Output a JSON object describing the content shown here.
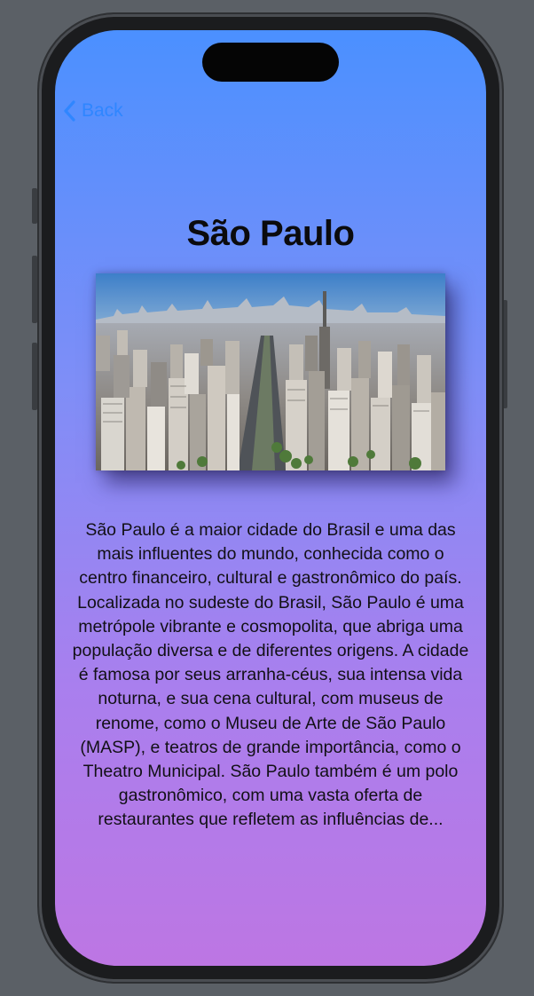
{
  "nav": {
    "back_label": "Back"
  },
  "city": {
    "title": "São Paulo",
    "image_alt": "Aerial view of São Paulo skyline along Avenida Paulista",
    "description": "São Paulo é a maior cidade do Brasil e uma das mais influentes do mundo, conhecida como o centro financeiro, cultural e gastronômico do país. Localizada no sudeste do Brasil, São Paulo é uma metrópole vibrante e cosmopolita, que abriga uma população diversa e de diferentes origens. A cidade é famosa por seus arranha-céus, sua intensa vida noturna, e sua cena cultural, com museus de renome, como o Museu de Arte de São Paulo (MASP), e teatros de grande importância, como o Theatro Municipal. São Paulo também é um polo gastronômico, com uma vasta oferta de restaurantes que refletem as influências de..."
  },
  "colors": {
    "gradient_top": "#4b90ff",
    "gradient_bottom": "#bd76e3",
    "accent": "#2f86ff",
    "title_text": "#0b0b0d"
  },
  "icons": {
    "back": "chevron-left-icon"
  }
}
